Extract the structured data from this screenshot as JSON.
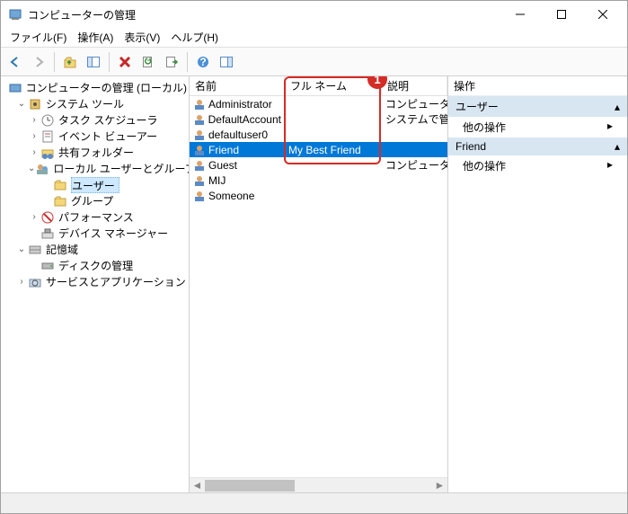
{
  "window": {
    "title": "コンピューターの管理"
  },
  "menus": {
    "file": "ファイル(F)",
    "action": "操作(A)",
    "view": "表示(V)",
    "help": "ヘルプ(H)"
  },
  "tree": {
    "root": "コンピューターの管理 (ローカル)",
    "system_tools": "システム ツール",
    "task_scheduler": "タスク スケジューラ",
    "event_viewer": "イベント ビューアー",
    "shared_folders": "共有フォルダー",
    "local_users_groups": "ローカル ユーザーとグループ",
    "users": "ユーザー",
    "groups": "グループ",
    "performance": "パフォーマンス",
    "device_manager": "デバイス マネージャー",
    "storage": "記憶域",
    "disk_management": "ディスクの管理",
    "services_apps": "サービスとアプリケーション"
  },
  "columns": {
    "name": "名前",
    "fullname": "フル ネーム",
    "description": "説明"
  },
  "rows": [
    {
      "name": "Administrator",
      "fullname": "",
      "description": "コンピューター/ド"
    },
    {
      "name": "DefaultAccount",
      "fullname": "",
      "description": "システムで管理さ"
    },
    {
      "name": "defaultuser0",
      "fullname": "",
      "description": ""
    },
    {
      "name": "Friend",
      "fullname": "My Best Friend",
      "description": "",
      "selected": true
    },
    {
      "name": "Guest",
      "fullname": "",
      "description": "コンピューター/ド"
    },
    {
      "name": "MIJ",
      "fullname": "",
      "description": ""
    },
    {
      "name": "Someone",
      "fullname": "",
      "description": ""
    }
  ],
  "actions": {
    "header": "操作",
    "section1": "ユーザー",
    "item": "他の操作",
    "section2": "Friend"
  },
  "callout": {
    "number": "1"
  }
}
